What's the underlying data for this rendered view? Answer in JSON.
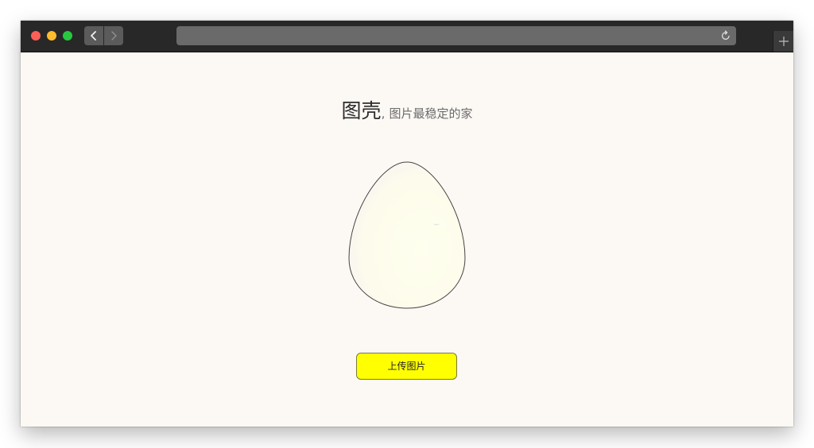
{
  "browser": {
    "traffic_lights": [
      "close",
      "minimize",
      "zoom"
    ],
    "icons": {
      "back": "chevron-left-icon",
      "forward": "chevron-right-icon",
      "reload": "reload-icon",
      "new_tab": "plus-icon"
    },
    "address_text": ""
  },
  "page": {
    "brand": "图壳",
    "separator": ",",
    "tagline": "图片最稳定的家",
    "upload_label": "上传图片"
  },
  "colors": {
    "background": "#fcf9f5",
    "button": "#ffff00",
    "egg_fill": "#fffef0",
    "titlebar": "#282828"
  }
}
